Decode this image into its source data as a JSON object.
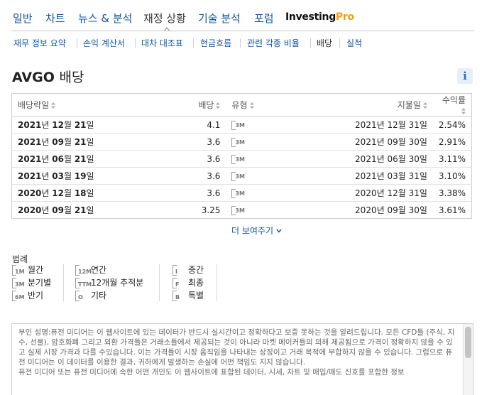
{
  "topnav": {
    "items": [
      "일반",
      "차트",
      "뉴스 & 분석",
      "재정 상황",
      "기술 분석",
      "포럼"
    ],
    "pro_prefix": "Investing",
    "pro_suffix": "Pro"
  },
  "subnav": {
    "items": [
      "재무 정보 요약",
      "손익 계산서",
      "대차 대조표",
      "현금흐름",
      "관련 각종 비율",
      "배당",
      "실적"
    ]
  },
  "page": {
    "ticker": "AVGO",
    "title_suffix": "배당",
    "info_label": "i"
  },
  "table": {
    "headers": [
      "배당락일",
      "배당",
      "유형",
      "지불일",
      "수익률"
    ],
    "rows": [
      {
        "ex_date_prefix": "2021",
        "ex_year_unit": "년 ",
        "ex_month": "12",
        "ex_month_unit": "월 ",
        "ex_day": "21",
        "ex_day_unit": "일",
        "dividend": "4.1",
        "type": "3M",
        "pay_date": "2021년 12월 31일",
        "yield": "2.54%"
      },
      {
        "ex_date_prefix": "2021",
        "ex_year_unit": "년 ",
        "ex_month": "09",
        "ex_month_unit": "월 ",
        "ex_day": "21",
        "ex_day_unit": "일",
        "dividend": "3.6",
        "type": "3M",
        "pay_date": "2021년 09월 30일",
        "yield": "2.91%"
      },
      {
        "ex_date_prefix": "2021",
        "ex_year_unit": "년 ",
        "ex_month": "06",
        "ex_month_unit": "월 ",
        "ex_day": "21",
        "ex_day_unit": "일",
        "dividend": "3.6",
        "type": "3M",
        "pay_date": "2021년 06월 30일",
        "yield": "3.11%"
      },
      {
        "ex_date_prefix": "2021",
        "ex_year_unit": "년 ",
        "ex_month": "03",
        "ex_month_unit": "월 ",
        "ex_day": "19",
        "ex_day_unit": "일",
        "dividend": "3.6",
        "type": "3M",
        "pay_date": "2021년 03월 31일",
        "yield": "3.10%"
      },
      {
        "ex_date_prefix": "2020",
        "ex_year_unit": "년 ",
        "ex_month": "12",
        "ex_month_unit": "월 ",
        "ex_day": "18",
        "ex_day_unit": "일",
        "dividend": "3.6",
        "type": "3M",
        "pay_date": "2020년 12월 31일",
        "yield": "3.38%"
      },
      {
        "ex_date_prefix": "2020",
        "ex_year_unit": "년 ",
        "ex_month": "09",
        "ex_month_unit": "월 ",
        "ex_day": "21",
        "ex_day_unit": "일",
        "dividend": "3.25",
        "type": "3M",
        "pay_date": "2020년 09월 30일",
        "yield": "3.61%"
      }
    ]
  },
  "show_more": "더 보여주기",
  "legend": {
    "title": "범례",
    "items": [
      {
        "code": "1M",
        "label": "월간"
      },
      {
        "code": "3M",
        "label": "분기별"
      },
      {
        "code": "6M",
        "label": "반기"
      },
      {
        "code": "12M",
        "label": "연간"
      },
      {
        "code": "TTM",
        "label": "12개월 추적분"
      },
      {
        "code": "O",
        "label": "기타"
      },
      {
        "code": "I",
        "label": "중간"
      },
      {
        "code": "F",
        "label": "최종"
      },
      {
        "code": "B",
        "label": "특별"
      }
    ]
  },
  "disclaimer": {
    "text": "부인 성명:퓨전 미디어는 이 웹사이트에 있는 데이터가 반드시 실시간이고 정확하다고 보증 못하는 것을 알려드립니다. 모든 CFD들 (주식, 지수, 선물), 암호화폐 그리고 외환 가격들은 거래소들에서 제공되는 것이 아니라 마켓 메이커들의 의해 제공됨으로 가격이 정확하지 않을 수 있고 실제 시장 가격과 다를 수있습니다. 이는 가격들이 시장 움직임을 나타내는 상징이고 거래 목적에 부합하지 않을 수 있습니다. 그럼으로 퓨전 미디어는 이 데이터를 이용한 결과, 귀하에게 발생하는 손실에 어떤 책임도 지지 않습니다.",
    "text2": "퓨전 미디어 또는 퓨전 미디어에 속한 어떤 개인도 이 웹사이트에 표함된 데이터, 시세, 차트 및 매입/매도 신호를 포함한 정보"
  },
  "colors": {
    "link": "#1256a0",
    "pro_accent": "#f4a100"
  }
}
